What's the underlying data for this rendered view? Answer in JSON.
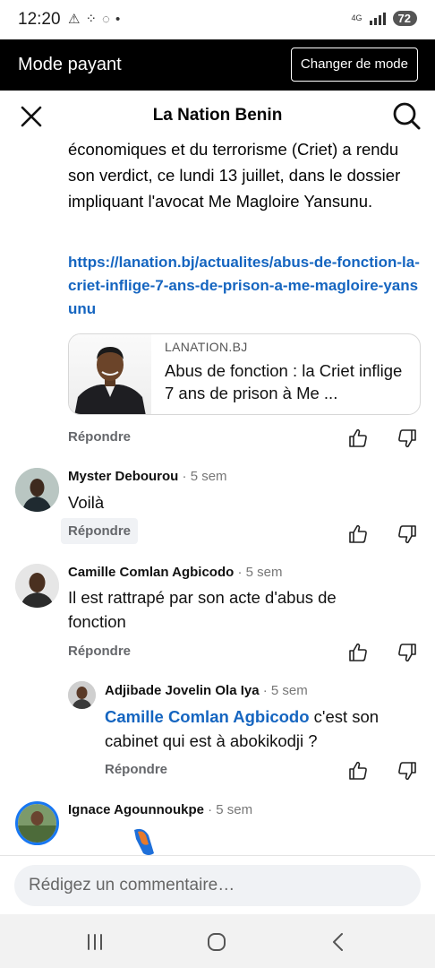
{
  "status_bar": {
    "time": "12:20",
    "network": "4G",
    "battery": "72"
  },
  "banner": {
    "label": "Mode payant",
    "button": "Changer de mode"
  },
  "header": {
    "title": "La Nation Benin"
  },
  "post": {
    "text": "économiques et du terrorisme (Criet) a rendu son verdict, ce lundi 13 juillet, dans le dossier impliquant l'avocat Me Magloire Yansunu.",
    "link": "https://lanation.bj/actualites/abus-de-fonction-la-criet-inflige-7-ans-de-prison-a-me-magloire-yansunu",
    "preview": {
      "domain": "LANATION.BJ",
      "title": "Abus de fonction : la Criet inflige 7 ans de prison à Me ..."
    },
    "reply_label": "Répondre"
  },
  "comments": [
    {
      "author": "Myster Debourou",
      "time": "5 sem",
      "text": "Voilà",
      "reply_label": "Répondre"
    },
    {
      "author": "Camille Comlan Agbicodo",
      "time": "5 sem",
      "text": "Il est rattrapé par son acte d'abus de fonction",
      "reply_label": "Répondre"
    },
    {
      "author": "Adjibade Jovelin Ola Iya",
      "time": "5 sem",
      "mention": "Camille Comlan Agbicodo",
      "text": " c'est son cabinet qui est à abokikodji ?",
      "reply_label": "Répondre"
    },
    {
      "author": "Ignace Agounnoukpe",
      "time": "5 sem"
    }
  ],
  "time_separator": " · ",
  "composer": {
    "placeholder": "Rédigez un commentaire…"
  },
  "colors": {
    "link": "#1565c0",
    "banner_bg": "#000000",
    "muted": "#65676b"
  },
  "icons": {
    "close": "close-icon",
    "search": "search-icon",
    "like": "thumbs-up-icon",
    "dislike": "thumbs-down-icon",
    "nav_recents": "recents-icon",
    "nav_home": "home-icon",
    "nav_back": "back-icon"
  }
}
